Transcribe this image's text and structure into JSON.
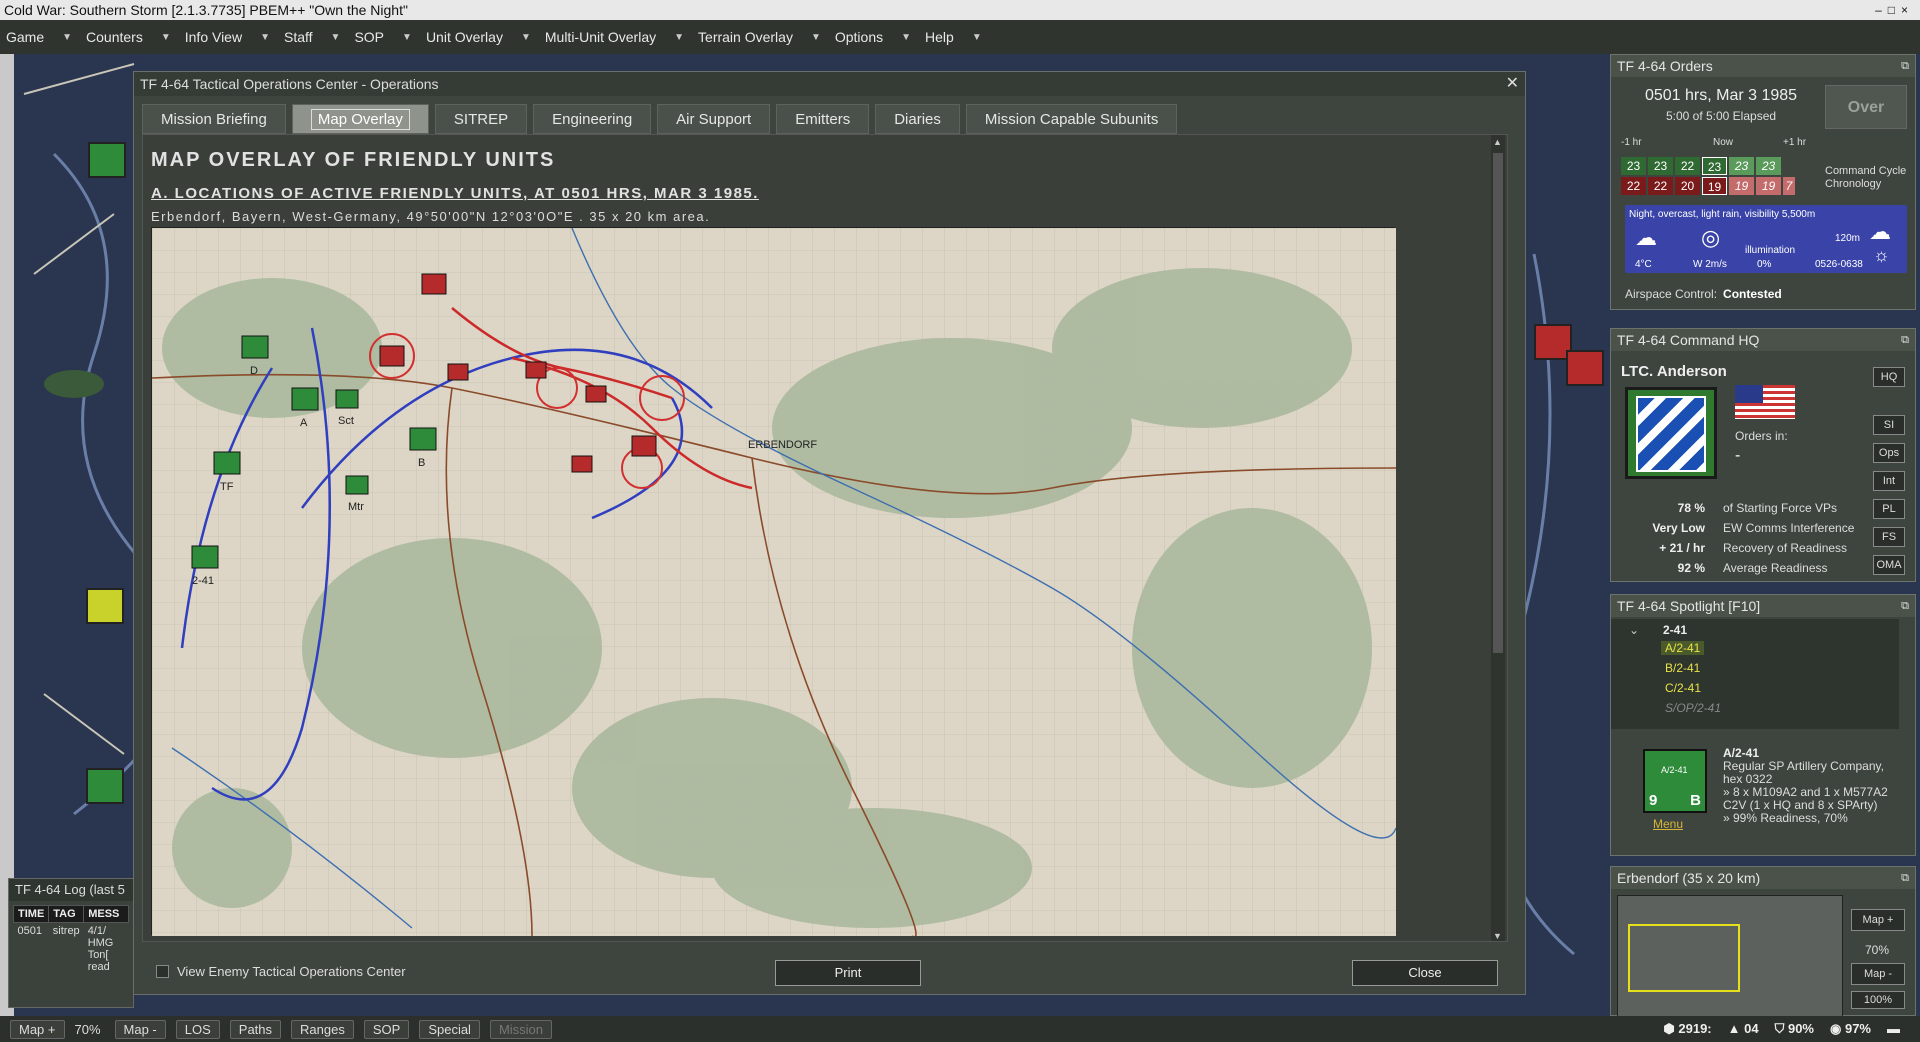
{
  "app": {
    "title": "Cold War: Southern Storm  [2.1.3.7735]  PBEM++ \"Own the Night\""
  },
  "menu": [
    "Game",
    "Counters",
    "Info View",
    "Staff",
    "SOP",
    "Unit Overlay",
    "Multi-Unit Overlay",
    "Terrain Overlay",
    "Options",
    "Help"
  ],
  "dialog": {
    "title": "TF 4-64 Tactical Operations Center - Operations",
    "tabs": [
      "Mission Briefing",
      "Map Overlay",
      "SITREP",
      "Engineering",
      "Air Support",
      "Emitters",
      "Diaries",
      "Mission Capable Subunits"
    ],
    "active_tab": "Map Overlay",
    "heading": "MAP OVERLAY OF FRIENDLY UNITS",
    "subheading": "A. LOCATIONS OF ACTIVE FRIENDLY UNITS, AT 0501 HRS, MAR 3 1985.",
    "location": "Erbendorf, Bayern, West-Germany, 49°50'00\"N 12°03'0O\"E . 35 x 20 km area.",
    "checkbox_label": "View Enemy Tactical Operations Center",
    "print_label": "Print",
    "close_label": "Close"
  },
  "map_labels": {
    "town": "ERBENDORF",
    "units": [
      "D",
      "A",
      "Sct",
      "TF",
      "B",
      "Mtr",
      "2-41"
    ]
  },
  "log": {
    "title": "TF 4-64 Log (last 5",
    "headers": [
      "TIME",
      "TAG",
      "MESS"
    ],
    "rows": [
      {
        "time": "0501",
        "tag": "sitrep",
        "msg": "4/1/ HMG Ton[ read"
      }
    ]
  },
  "orders": {
    "title": "TF 4-64 Orders",
    "time": "0501 hrs, Mar 3 1985",
    "elapsed": "5:00 of 5:00 Elapsed",
    "over": "Over",
    "chron_labels": {
      "minus": "-1 hr",
      "now": "Now",
      "plus": "+1 hr"
    },
    "row1": [
      "23",
      "23",
      "22",
      "23",
      "23",
      "23"
    ],
    "row2": [
      "22",
      "22",
      "20",
      "19",
      "19",
      "19",
      "7"
    ],
    "chron_note": "Command Cycle Chronology",
    "weather": "Night, overcast, light rain, visibility 5,500m",
    "temp": "4°C",
    "wind": "W 2m/s",
    "illum_label": "illumination",
    "illum": "0%",
    "cloud": "120m",
    "sun": "0526-0638",
    "airspace_label": "Airspace Control:",
    "airspace": "Contested"
  },
  "cmdhq": {
    "title": "TF 4-64 Command HQ",
    "name": "LTC. Anderson",
    "orders_in": "Orders in:",
    "orders_val": "-",
    "stats": [
      {
        "v": "78 %",
        "l": "of Starting Force VPs"
      },
      {
        "v": "Very Low",
        "l": "EW Comms Interference"
      },
      {
        "v": "+ 21 / hr",
        "l": "Recovery of Readiness"
      },
      {
        "v": "92 %",
        "l": "Average Readiness"
      }
    ],
    "buttons": [
      "HQ",
      "SI",
      "Ops",
      "Int",
      "PL",
      "FS",
      "OMA"
    ]
  },
  "spotlight": {
    "title": "TF 4-64 Spotlight   [F10]",
    "items": [
      "2-41",
      "A/2-41",
      "B/2-41",
      "C/2-41",
      "S/OP/2-41"
    ],
    "unit_top": "A/2-41",
    "unit_num": "9",
    "unit_size": "B",
    "menu": "Menu",
    "name": "A/2-41",
    "desc": "Regular SP Artillery Company, hex 0322",
    "equip": "» 8 x M109A2 and 1 x M577A2 C2V (1 x HQ and 8 x SPArty)",
    "ready": "» 99% Readiness, 70%"
  },
  "minimap": {
    "title": "Erbendorf (35 x 20 km)",
    "map_plus": "Map +",
    "zoom": "70%",
    "map_minus": "Map -",
    "full": "100%"
  },
  "statusbar": {
    "buttons": [
      "Map +",
      "Map -",
      "LOS",
      "Paths",
      "Ranges",
      "SOP",
      "Special"
    ],
    "zoom": "70%",
    "mission": "Mission",
    "vp": "2919:",
    "v1": "04",
    "v2": "90%",
    "v3": "97%"
  }
}
